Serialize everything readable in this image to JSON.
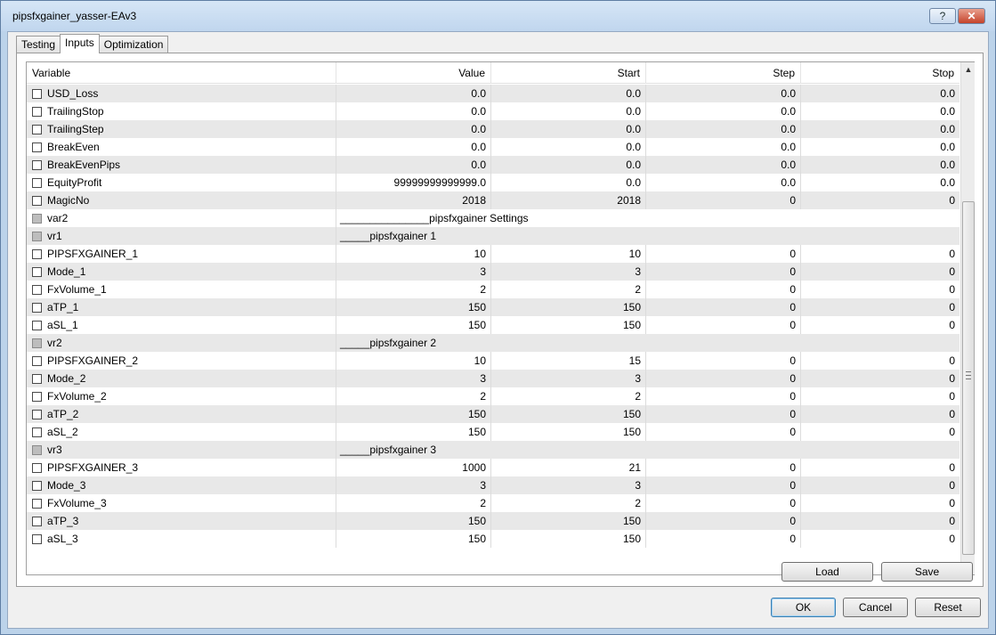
{
  "window": {
    "title": "pipsfxgainer_yasser-EAv3",
    "help_label": "?",
    "close_label": "✕"
  },
  "tabs": [
    {
      "label": "Testing",
      "active": false
    },
    {
      "label": "Inputs",
      "active": true
    },
    {
      "label": "Optimization",
      "active": false
    }
  ],
  "grid": {
    "columns": [
      "Variable",
      "Value",
      "Start",
      "Step",
      "Stop"
    ],
    "rows": [
      {
        "name": "USD_Loss",
        "value": "0.0",
        "start": "0.0",
        "step": "0.0",
        "stop": "0.0"
      },
      {
        "name": "TrailingStop",
        "value": "0.0",
        "start": "0.0",
        "step": "0.0",
        "stop": "0.0"
      },
      {
        "name": "TrailingStep",
        "value": "0.0",
        "start": "0.0",
        "step": "0.0",
        "stop": "0.0"
      },
      {
        "name": "BreakEven",
        "value": "0.0",
        "start": "0.0",
        "step": "0.0",
        "stop": "0.0"
      },
      {
        "name": "BreakEvenPips",
        "value": "0.0",
        "start": "0.0",
        "step": "0.0",
        "stop": "0.0"
      },
      {
        "name": "EquityProfit",
        "value": "99999999999999.0",
        "start": "0.0",
        "step": "0.0",
        "stop": "0.0"
      },
      {
        "name": "MagicNo",
        "value": "2018",
        "start": "2018",
        "step": "0",
        "stop": "0"
      },
      {
        "name": "var2",
        "text": "_______________pipsfxgainer Settings",
        "section": true
      },
      {
        "name": "vr1",
        "text": "_____pipsfxgainer 1",
        "section": true
      },
      {
        "name": "PIPSFXGAINER_1",
        "value": "10",
        "start": "10",
        "step": "0",
        "stop": "0"
      },
      {
        "name": "Mode_1",
        "value": "3",
        "start": "3",
        "step": "0",
        "stop": "0"
      },
      {
        "name": "FxVolume_1",
        "value": "2",
        "start": "2",
        "step": "0",
        "stop": "0"
      },
      {
        "name": "aTP_1",
        "value": "150",
        "start": "150",
        "step": "0",
        "stop": "0"
      },
      {
        "name": "aSL_1",
        "value": "150",
        "start": "150",
        "step": "0",
        "stop": "0"
      },
      {
        "name": "vr2",
        "text": "_____pipsfxgainer 2",
        "section": true
      },
      {
        "name": "PIPSFXGAINER_2",
        "value": "10",
        "start": "15",
        "step": "0",
        "stop": "0"
      },
      {
        "name": "Mode_2",
        "value": "3",
        "start": "3",
        "step": "0",
        "stop": "0"
      },
      {
        "name": "FxVolume_2",
        "value": "2",
        "start": "2",
        "step": "0",
        "stop": "0"
      },
      {
        "name": "aTP_2",
        "value": "150",
        "start": "150",
        "step": "0",
        "stop": "0"
      },
      {
        "name": "aSL_2",
        "value": "150",
        "start": "150",
        "step": "0",
        "stop": "0"
      },
      {
        "name": "vr3",
        "text": "_____pipsfxgainer 3",
        "section": true
      },
      {
        "name": "PIPSFXGAINER_3",
        "value": "1000",
        "start": "21",
        "step": "0",
        "stop": "0"
      },
      {
        "name": "Mode_3",
        "value": "3",
        "start": "3",
        "step": "0",
        "stop": "0"
      },
      {
        "name": "FxVolume_3",
        "value": "2",
        "start": "2",
        "step": "0",
        "stop": "0"
      },
      {
        "name": "aTP_3",
        "value": "150",
        "start": "150",
        "step": "0",
        "stop": "0"
      },
      {
        "name": "aSL_3",
        "value": "150",
        "start": "150",
        "step": "0",
        "stop": "0"
      }
    ]
  },
  "scrollbar": {
    "up_icon": "▲",
    "down_icon": "▼"
  },
  "buttons": {
    "load": "Load",
    "save": "Save",
    "ok": "OK",
    "cancel": "Cancel",
    "reset": "Reset"
  }
}
